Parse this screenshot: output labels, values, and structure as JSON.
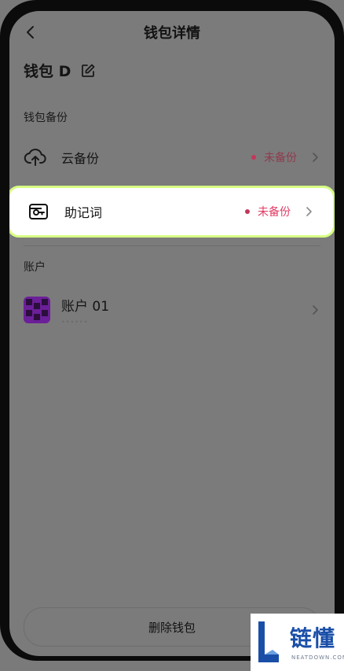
{
  "header": {
    "title": "钱包详情"
  },
  "wallet": {
    "name": "钱包 D"
  },
  "backup_section": {
    "label": "钱包备份",
    "items": [
      {
        "label": "云备份",
        "status": "未备份"
      },
      {
        "label": "助记词",
        "status": "未备份"
      }
    ]
  },
  "accounts_section": {
    "label": "账户",
    "items": [
      {
        "name": "账户 01",
        "subtitle": "••••••"
      }
    ]
  },
  "actions": {
    "delete_label": "删除钱包"
  },
  "watermark": {
    "brand": "链懂",
    "domain": "NEATDOWN.COM"
  },
  "colors": {
    "accent_highlight": "#d7ff83",
    "status_red": "#e23b63",
    "avatar_purple": "#6b1f98"
  }
}
